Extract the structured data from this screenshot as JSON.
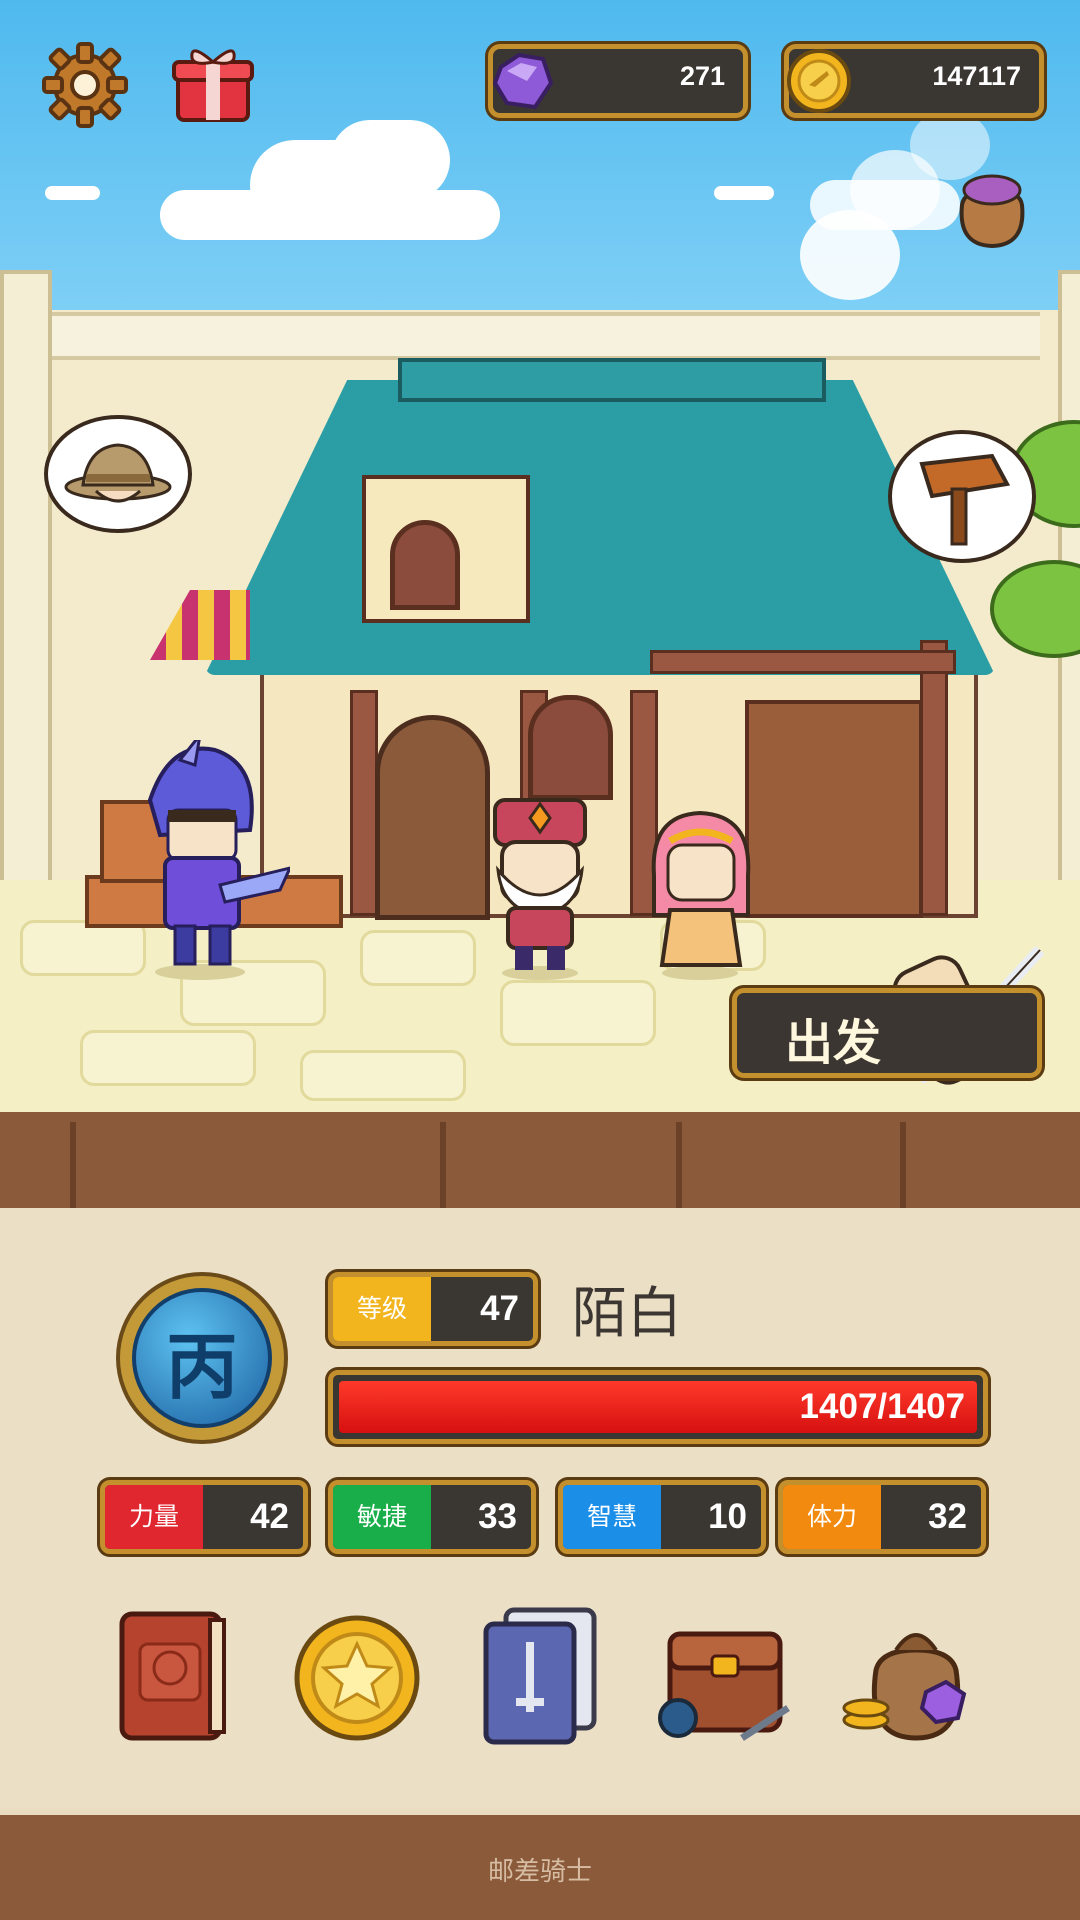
{
  "resources": {
    "gems": "271",
    "coins": "147117"
  },
  "scene": {
    "go_button_label": "出发"
  },
  "hero": {
    "rank_glyph": "丙",
    "level_label": "等级",
    "level_value": "47",
    "name": "陌白",
    "hp_text": "1407/1407",
    "hp_fraction": 1.0
  },
  "stats": [
    {
      "label": "力量",
      "value": "42",
      "color": "#e0262f"
    },
    {
      "label": "敏捷",
      "value": "33",
      "color": "#1aae4a"
    },
    {
      "label": "智慧",
      "value": "10",
      "color": "#1b8ee8"
    },
    {
      "label": "体力",
      "value": "32",
      "color": "#f28a10"
    }
  ],
  "level_color": "#f2b51e",
  "menu": [
    {
      "icon": "hero-book-icon"
    },
    {
      "icon": "star-coin-icon"
    },
    {
      "icon": "sword-cards-icon"
    },
    {
      "icon": "backpack-icon"
    },
    {
      "icon": "treasure-bag-icon"
    }
  ],
  "footer": {
    "title": "邮差骑士"
  }
}
